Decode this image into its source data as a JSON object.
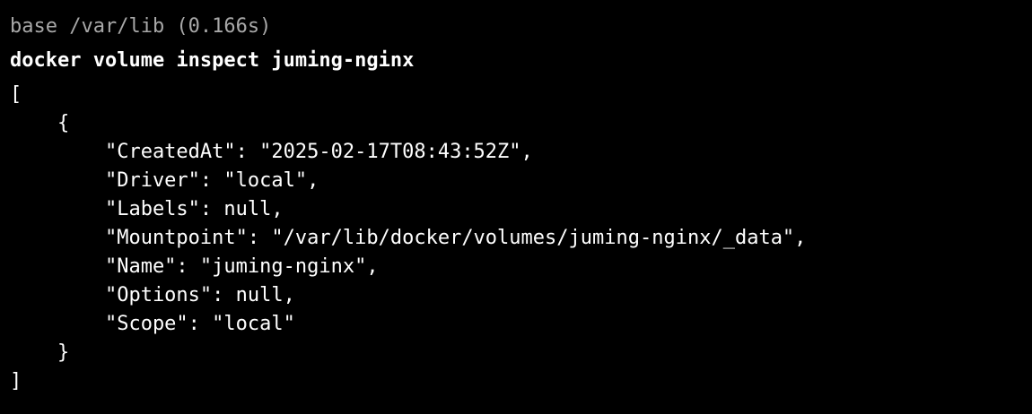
{
  "prompt": {
    "text": "base /var/lib (0.166s)"
  },
  "command": {
    "text": "docker volume inspect juming-nginx"
  },
  "output": {
    "lines": [
      "[",
      "    {",
      "        \"CreatedAt\": \"2025-02-17T08:43:52Z\",",
      "        \"Driver\": \"local\",",
      "        \"Labels\": null,",
      "        \"Mountpoint\": \"/var/lib/docker/volumes/juming-nginx/_data\",",
      "        \"Name\": \"juming-nginx\",",
      "        \"Options\": null,",
      "        \"Scope\": \"local\"",
      "    }",
      "]"
    ]
  },
  "colors": {
    "background": "#000000",
    "prompt": "#a8a8a8",
    "text": "#ffffff"
  }
}
